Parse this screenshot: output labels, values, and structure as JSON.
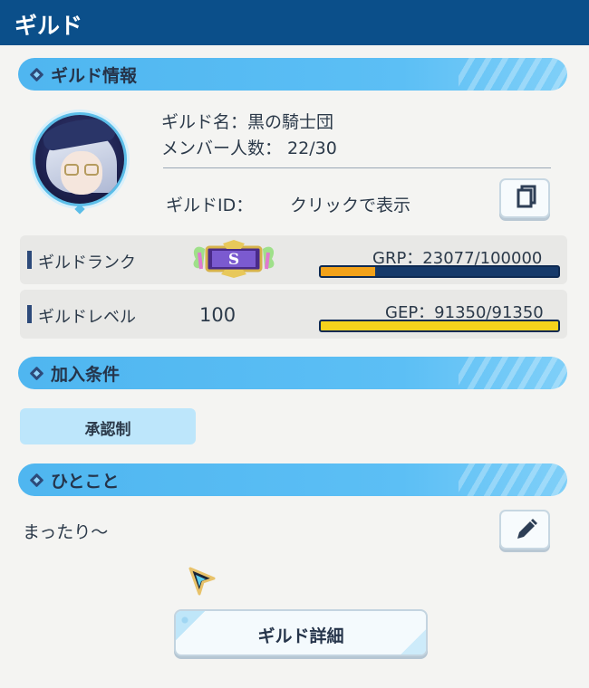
{
  "header": {
    "title": "ギルド"
  },
  "sections": {
    "guild_info": "ギルド情報",
    "join_conditions": "加入条件",
    "message": "ひとこと"
  },
  "guild": {
    "name_line": "ギルド名：黒の騎士団",
    "members_line": "メンバー人数： 22/30",
    "id_label": "ギルドID：",
    "id_value": "クリックで表示"
  },
  "rank": {
    "label": "ギルドランク",
    "badge_letter": "S",
    "grp_text": "GRP：23077/100000",
    "progress": 0.23077,
    "bar_color": "#f2a21a"
  },
  "level": {
    "label": "ギルドレベル",
    "value": "100",
    "gep_text": "GEP：91350/91350",
    "progress": 1.0,
    "bar_color": "#f6d21c"
  },
  "join": {
    "condition": "承認制"
  },
  "message": {
    "text": "まったり～"
  },
  "buttons": {
    "detail": "ギルド詳細"
  },
  "icons": {
    "copy": "copy-icon",
    "edit": "pencil-icon"
  },
  "colors": {
    "header_bg": "#0b4f8a",
    "section_bg": "#5cbff5",
    "tag_bg": "#bde6fb"
  }
}
